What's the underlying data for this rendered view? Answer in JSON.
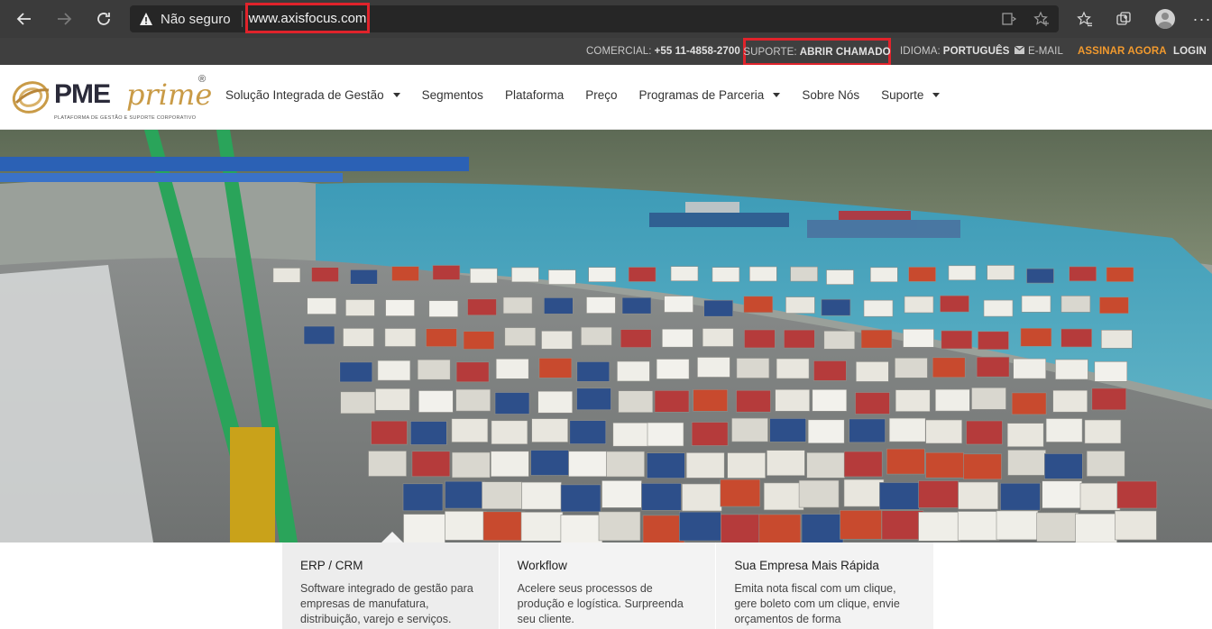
{
  "browser": {
    "security_label": "Não seguro",
    "url": "www.axisfocus.com",
    "back_icon": "arrow-left-icon",
    "forward_icon": "arrow-right-icon",
    "reload_icon": "reload-icon",
    "accent": "#e0232b"
  },
  "topbar": {
    "comercial_label": "COMERCIAL:",
    "comercial_value": "+55 11-4858-2700",
    "suporte_label": "SUPORTE:",
    "suporte_value": "ABRIR CHAMADO",
    "idioma_label": "IDIOMA:",
    "idioma_value": "PORTUGUÊS",
    "email_label": "E-MAIL",
    "assinar_label": "ASSINAR AGORA",
    "login_label": "LOGIN",
    "assinar_color": "#f29a2e"
  },
  "header": {
    "logo_pme": "PME",
    "logo_prime": "prime",
    "logo_reg": "®",
    "logo_tagline": "PLATAFORMA DE GESTÃO E SUPORTE CORPORATIVO",
    "nav": [
      {
        "label": "Solução Integrada de Gestão",
        "dropdown": true
      },
      {
        "label": "Segmentos",
        "dropdown": false
      },
      {
        "label": "Plataforma",
        "dropdown": false
      },
      {
        "label": "Preço",
        "dropdown": false
      },
      {
        "label": "Programas de Parceria",
        "dropdown": true
      },
      {
        "label": "Sobre Nós",
        "dropdown": false
      },
      {
        "label": "Suporte",
        "dropdown": true
      }
    ]
  },
  "features": [
    {
      "title": "ERP / CRM",
      "text": "Software integrado de gestão para empresas de manufatura, distribuição, varejo e serviços."
    },
    {
      "title": "Workflow",
      "text": "Acelere seus processos de produção e logística. Surpreenda seu cliente."
    },
    {
      "title": "Sua Empresa Mais Rápida",
      "text": "Emita nota fiscal com um clique, gere boleto com um clique, envie orçamentos de forma"
    }
  ]
}
